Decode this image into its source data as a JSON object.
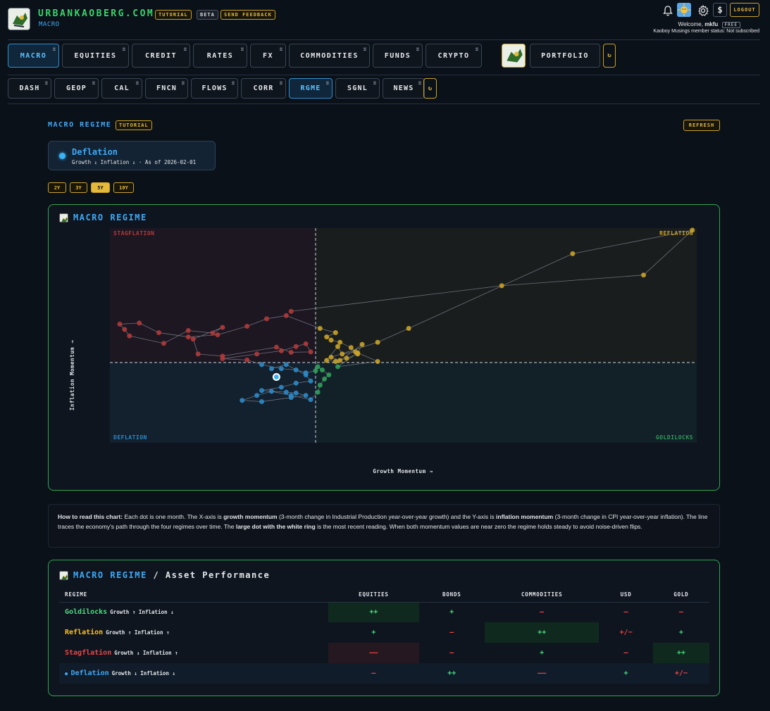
{
  "header": {
    "brand": "URBANKAOBERG.COM",
    "section": "MACRO",
    "tutorial": "TUTORIAL",
    "beta": "BETA",
    "feedback": "SEND FEEDBACK",
    "logout": "LOGOUT",
    "welcome_prefix": "Welcome,",
    "username": "mkfu",
    "plan": "FREE",
    "member_status": "Kaoboy Musings member status: Not subscribed",
    "icons": [
      "bell-icon",
      "avatar-icon",
      "gear-icon",
      "dollar-icon"
    ]
  },
  "nav": {
    "items": [
      {
        "label": "MACRO",
        "active": true
      },
      {
        "label": "EQUITIES"
      },
      {
        "label": "CREDIT"
      },
      {
        "label": "RATES"
      },
      {
        "label": "FX"
      },
      {
        "label": "COMMODITIES"
      },
      {
        "label": "FUNDS"
      },
      {
        "label": "CRYPTO"
      }
    ],
    "portfolio": "PORTFOLIO",
    "menu_glyph": "≡",
    "refresh_glyph": "↻"
  },
  "subnav": {
    "items": [
      {
        "label": "DASH"
      },
      {
        "label": "GEOP"
      },
      {
        "label": "CAL"
      },
      {
        "label": "FNCN"
      },
      {
        "label": "FLOWS"
      },
      {
        "label": "CORR"
      },
      {
        "label": "RGME",
        "active": true
      },
      {
        "label": "SGNL"
      },
      {
        "label": "NEWS"
      }
    ]
  },
  "page": {
    "title": "MACRO REGIME",
    "tutorial": "TUTORIAL",
    "refresh": "REFRESH",
    "current_regime": "Deflation",
    "current_sub": "Growth ↓ Inflation ↓ · As of 2026-02-01",
    "ranges": [
      "2Y",
      "3Y",
      "5Y",
      "10Y"
    ],
    "active_range": "5Y"
  },
  "chart_panel": {
    "title": "MACRO REGIME"
  },
  "chart_data": {
    "type": "scatter",
    "xlabel": "Growth Momentum →",
    "ylabel": "Inflation Momentum →",
    "quadrants": {
      "top_left": "STAGFLATION",
      "top_right": "REFLATION",
      "bottom_left": "DEFLATION",
      "bottom_right": "GOLDILOCKS"
    },
    "colors": {
      "Stagflation": "#b03a3a",
      "Reflation": "#c9a227",
      "Deflation": "#2b8ac8",
      "Goldilocks": "#2f9e5a",
      "line": "#8a8f98"
    },
    "axis_note": "values are relative positions; axes carry no tick labels",
    "path": [
      [
        -0.45,
        -0.15
      ],
      [
        -0.3,
        -0.05
      ],
      [
        -0.1,
        -0.3
      ],
      [
        -0.05,
        -0.45
      ],
      [
        -0.2,
        -0.5
      ],
      [
        -0.35,
        -0.6
      ],
      [
        -0.55,
        -0.68
      ],
      [
        -0.3,
        -0.72
      ],
      [
        -0.2,
        -0.74
      ],
      [
        -0.1,
        -0.8
      ],
      [
        -0.25,
        -0.85
      ],
      [
        -0.55,
        -0.95
      ],
      [
        -0.75,
        -0.92
      ],
      [
        -0.6,
        -0.8
      ],
      [
        -0.45,
        -0.7
      ],
      [
        -0.25,
        -0.8
      ],
      [
        -0.05,
        -0.9
      ],
      [
        0.05,
        -0.72
      ],
      [
        0.1,
        -0.55
      ],
      [
        0.2,
        -0.4
      ],
      [
        0.3,
        -0.3
      ],
      [
        0.15,
        -0.18
      ],
      [
        0.05,
        -0.1
      ],
      [
        0.0,
        -0.2
      ],
      [
        -0.1,
        -0.25
      ],
      [
        -0.2,
        -0.18
      ],
      [
        -0.35,
        -0.15
      ],
      [
        -0.55,
        -0.05
      ],
      [
        -0.7,
        0.12
      ],
      [
        -0.95,
        0.18
      ],
      [
        -0.6,
        0.4
      ],
      [
        -0.35,
        0.55
      ],
      [
        -0.2,
        0.75
      ],
      [
        -0.1,
        0.88
      ],
      [
        -0.05,
        0.5
      ],
      [
        -0.25,
        0.48
      ],
      [
        -0.4,
        0.72
      ],
      [
        -0.95,
        0.3
      ],
      [
        -1.2,
        0.4
      ],
      [
        -1.25,
        1.1
      ],
      [
        -0.95,
        1.65
      ],
      [
        -1.05,
        1.38
      ],
      [
        -1.3,
        1.5
      ],
      [
        -1.55,
        0.9
      ],
      [
        -1.9,
        1.25
      ],
      [
        -1.95,
        1.55
      ],
      [
        -2.0,
        1.8
      ],
      [
        -1.8,
        1.85
      ],
      [
        -1.6,
        1.4
      ],
      [
        -1.3,
        1.2
      ],
      [
        -1.0,
        1.3
      ],
      [
        -0.7,
        1.7
      ],
      [
        -0.5,
        2.05
      ],
      [
        -0.3,
        2.2
      ],
      [
        0.1,
        1.6
      ],
      [
        0.45,
        1.4
      ],
      [
        0.25,
        1.2
      ],
      [
        0.35,
        1.05
      ],
      [
        0.55,
        0.95
      ],
      [
        0.8,
        0.7
      ],
      [
        0.95,
        0.4
      ],
      [
        0.7,
        0.2
      ],
      [
        0.45,
        0.05
      ],
      [
        0.25,
        0.1
      ],
      [
        0.5,
        0.75
      ],
      [
        0.6,
        0.4
      ],
      [
        0.9,
        0.5
      ],
      [
        1.4,
        0.05
      ],
      [
        0.5,
        -0.1
      ],
      [
        0.95,
        0.45
      ],
      [
        1.05,
        0.85
      ],
      [
        0.55,
        0.1
      ],
      [
        0.35,
        0.25
      ],
      [
        1.4,
        0.95
      ],
      [
        2.1,
        1.6
      ],
      [
        5.8,
        5.1
      ],
      [
        8.5,
        6.2
      ],
      [
        7.4,
        4.1
      ],
      [
        4.2,
        3.6
      ],
      [
        -0.25,
        2.4
      ]
    ],
    "current": [
      -0.4,
      -0.35
    ]
  },
  "howto": {
    "lead": "How to read this chart:",
    "t1": " Each dot is one month. The X-axis is ",
    "b1": "growth momentum",
    "t2": " (3-month change in Industrial Production year-over-year growth) and the Y-axis is ",
    "b2": "inflation momentum",
    "t3": " (3-month change in CPI year-over-year inflation). The line traces the economy's path through the four regimes over time. The ",
    "b3": "large dot with the white ring",
    "t4": " is the most recent reading. When both momentum values are near zero the regime holds steady to avoid noise-driven flips."
  },
  "perf_panel": {
    "title": "MACRO REGIME",
    "title_suffix": "/ Asset Performance",
    "headers": [
      "REGIME",
      "EQUITIES",
      "BONDS",
      "COMMODITIES",
      "USD",
      "GOLD"
    ],
    "rows": [
      {
        "name": "Goldilocks",
        "meta": "Growth ↑ Inflation ↓",
        "color": "#4ade80",
        "cells": [
          "++",
          "+",
          "–",
          "–",
          "–"
        ]
      },
      {
        "name": "Reflation",
        "meta": "Growth ↑ Inflation ↑",
        "color": "#fbbf24",
        "cells": [
          "+",
          "–",
          "++",
          "+/−",
          "+"
        ]
      },
      {
        "name": "Stagflation",
        "meta": "Growth ↓ Inflation ↑",
        "color": "#ef4444",
        "cells": [
          "––",
          "–",
          "+",
          "–",
          "++"
        ]
      },
      {
        "name": "Deflation",
        "meta": "Growth ↓ Inflation ↓",
        "color": "#3fa8f5",
        "current": true,
        "cells": [
          "–",
          "++",
          "––",
          "+",
          "+/−"
        ]
      }
    ]
  }
}
